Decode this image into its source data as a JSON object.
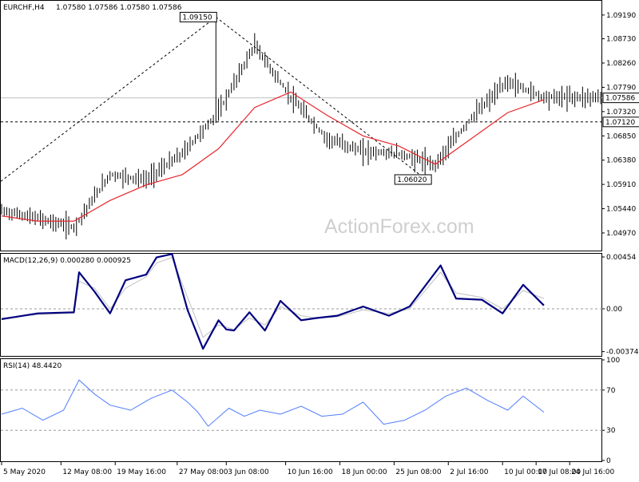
{
  "chart_data": {
    "type": "line",
    "symbol_label": "EURCHF,H4",
    "ohlc_readout": "1.07580 1.07586 1.07580 1.07586",
    "watermark": "ActionForex.com",
    "price": {
      "ylim": [
        1.0466,
        1.0945
      ],
      "yticks": [
        "1.09190",
        "1.08730",
        "1.08260",
        "1.07790",
        "1.07320",
        "1.06850",
        "1.06380",
        "1.05910",
        "1.05440",
        "1.04970"
      ],
      "current_label": "1.07586",
      "current_value": 1.07586,
      "level_label": "1.07120",
      "level_value": 1.0712,
      "high_label": "1.09150",
      "high_value": 1.0915,
      "high_index": 83,
      "low_label": "1.06020",
      "low_value": 1.0602,
      "low_index": 164,
      "trend_start": 1.0597,
      "x": [
        0,
        14,
        28,
        42,
        56,
        70,
        84,
        98,
        112,
        126,
        140,
        154,
        168,
        182,
        196,
        210
      ],
      "close": [
        1.054,
        1.0525,
        1.0508,
        1.061,
        1.06,
        1.065,
        1.073,
        1.086,
        1.076,
        1.068,
        1.0655,
        1.065,
        1.063,
        1.072,
        1.079,
        1.076
      ],
      "ma": [
        1.053,
        1.052,
        1.052,
        1.056,
        1.059,
        1.061,
        1.066,
        1.074,
        1.077,
        1.0725,
        1.0685,
        1.0665,
        1.063,
        1.068,
        1.073,
        1.0755
      ],
      "series": [
        {
          "color": "#000000"
        },
        {
          "color": "#e8262b"
        }
      ]
    },
    "macd": {
      "label": "MACD(12,26,9) 0.000280 0.000925",
      "ylim": [
        -0.00405,
        0.00475
      ],
      "yticks": [
        "0.00454",
        "0.00",
        "-0.003745"
      ],
      "ytick_values": [
        0.00454,
        0,
        -0.003745
      ],
      "zero": 0,
      "x": [
        0,
        14,
        28,
        30,
        36,
        42,
        48,
        56,
        60,
        66,
        72,
        78,
        84,
        87,
        90,
        96,
        102,
        108,
        116,
        122,
        130,
        140,
        150,
        158,
        170,
        176,
        186,
        194,
        202,
        210
      ],
      "main": [
        -0.0009,
        -0.0004,
        -0.0003,
        0.0032,
        0.0015,
        -0.0004,
        0.0025,
        0.003,
        0.0045,
        0.0048,
        -0.0001,
        -0.0035,
        -0.001,
        -0.0018,
        -0.0019,
        -0.0003,
        -0.0019,
        0.0007,
        -0.001,
        -0.0008,
        -0.0006,
        0.0002,
        -0.0006,
        0.0002,
        0.0038,
        0.0009,
        0.0008,
        -0.0004,
        0.0021,
        0.0003
      ],
      "signal": [
        -0.0008,
        -0.0005,
        -0.0004,
        0.0024,
        0.0018,
        0.0,
        0.0018,
        0.0028,
        0.004,
        0.0045,
        0.001,
        -0.0025,
        -0.0014,
        -0.0016,
        -0.0018,
        -0.0008,
        -0.0014,
        0.0002,
        -0.0006,
        -0.0008,
        -0.0007,
        -0.0001,
        -0.0004,
        0.0,
        0.0032,
        0.0014,
        0.001,
        0.0,
        0.0016,
        0.0009
      ],
      "series": [
        {
          "color": "#000080"
        },
        {
          "color": "#c0c0c0"
        }
      ]
    },
    "rsi": {
      "label": "RSI(14) 48.4420",
      "ylim": [
        0,
        100
      ],
      "yticks": [
        "100",
        "70",
        "30",
        "0"
      ],
      "ytick_values": [
        100,
        70,
        30,
        0
      ],
      "levels": [
        70,
        30
      ],
      "x": [
        0,
        8,
        16,
        24,
        30,
        36,
        42,
        50,
        58,
        66,
        72,
        76,
        80,
        88,
        94,
        100,
        108,
        116,
        124,
        132,
        140,
        148,
        156,
        164,
        172,
        180,
        188,
        196,
        202,
        210
      ],
      "values": [
        46,
        52,
        40,
        50,
        80,
        66,
        55,
        50,
        62,
        70,
        58,
        48,
        34,
        52,
        44,
        50,
        46,
        54,
        44,
        46,
        58,
        36,
        40,
        50,
        64,
        72,
        60,
        50,
        64,
        48
      ],
      "series": [
        {
          "color": "#4f7cff"
        }
      ]
    },
    "xticks": [
      {
        "label": "5 May 2020",
        "i": 0
      },
      {
        "label": "12 May 08:00",
        "i": 23
      },
      {
        "label": "19 May 16:00",
        "i": 44
      },
      {
        "label": "27 May 08:00",
        "i": 68
      },
      {
        "label": "3 Jun 08:00",
        "i": 87
      },
      {
        "label": "10 Jun 16:00",
        "i": 110
      },
      {
        "label": "18 Jun 00:00",
        "i": 131
      },
      {
        "label": "25 Jun 08:00",
        "i": 152
      },
      {
        "label": "2 Jul 16:00",
        "i": 173
      },
      {
        "label": "10 Jul 00:00",
        "i": 194
      },
      {
        "label": "17 Jul 08:00",
        "i": 207
      },
      {
        "label": "24 Jul 16:00",
        "i": 220
      }
    ],
    "xmax": 232,
    "grid": false,
    "colors": {
      "axis": "#000000",
      "level_line": "#000000",
      "current_line": "#c0c0c0",
      "label_box_bg": "#ffffff",
      "label_box_border": "#000000"
    }
  }
}
